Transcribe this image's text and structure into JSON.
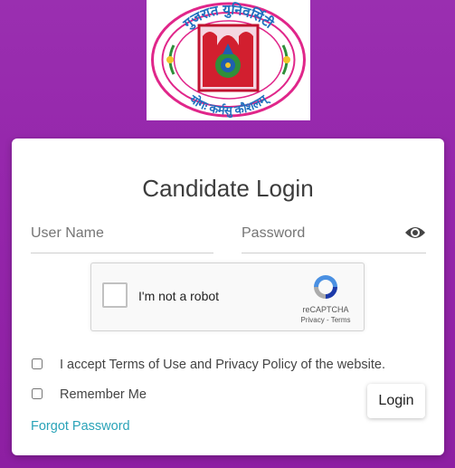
{
  "logo": {
    "top_text": "गुजरात युनिवर्सिटी",
    "bottom_text": "योगः कर्मसु कौशलम्"
  },
  "login": {
    "title": "Candidate Login",
    "username_placeholder": "User Name",
    "password_placeholder": "Password",
    "captcha": {
      "label": "I'm not a robot",
      "brand": "reCAPTCHA",
      "privacy": "Privacy",
      "separator": " - ",
      "terms": "Terms"
    },
    "accept_terms_label": "I accept Terms of Use and Privacy Policy of the website.",
    "remember_label": "Remember Me",
    "login_button": "Login",
    "forgot_link": "Forgot Password"
  },
  "colors": {
    "background": "#9526ab",
    "link": "#2aa3b8"
  }
}
